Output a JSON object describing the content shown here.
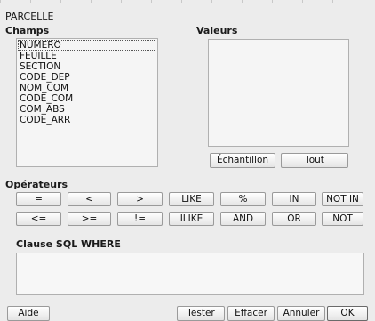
{
  "window": {
    "title": "PARCELLE"
  },
  "fields": {
    "label": "Champs",
    "items": [
      "NUMERO",
      "FEUILLE",
      "SECTION",
      "CODE_DEP",
      "NOM_COM",
      "CODE_COM",
      "COM_ABS",
      "CODE_ARR"
    ],
    "selected_index": 0
  },
  "values": {
    "label": "Valeurs",
    "sample_button": "Échantillon",
    "all_button": "Tout"
  },
  "operators": {
    "label": "Opérateurs",
    "row1": [
      "=",
      "<",
      ">",
      "LIKE",
      "%",
      "IN",
      "NOT IN"
    ],
    "row2": [
      "<=",
      ">=",
      "!=",
      "ILIKE",
      "AND",
      "OR",
      "NOT"
    ]
  },
  "where": {
    "label": "Clause SQL WHERE",
    "value": ""
  },
  "footer": {
    "help": "Aide",
    "test": "Tester",
    "clear": "Effacer",
    "cancel": "Annuler",
    "ok": "OK"
  }
}
